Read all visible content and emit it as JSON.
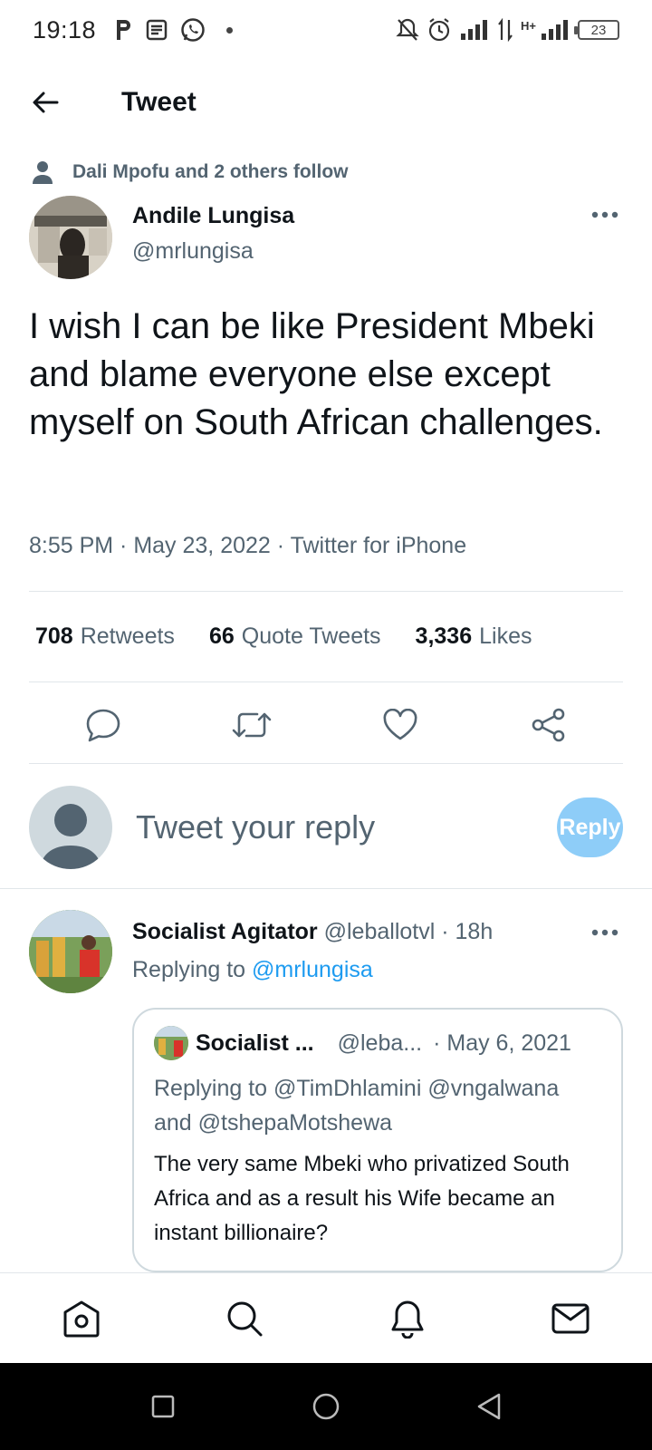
{
  "status_bar": {
    "time": "19:18",
    "battery": "23",
    "network": "H+"
  },
  "header": {
    "title": "Tweet",
    "back_icon": "arrow-left-icon"
  },
  "social_context": {
    "text": "Dali Mpofu and 2 others follow"
  },
  "tweet": {
    "author_name": "Andile Lungisa",
    "author_handle": "@mrlungisa",
    "text": "I wish I can be like President Mbeki and blame everyone else except myself on South African challenges.",
    "meta": "8:55 PM · May 23, 2022 · Twitter for iPhone",
    "stats": [
      {
        "count": "708",
        "label": "Retweets"
      },
      {
        "count": "66",
        "label": "Quote Tweets"
      },
      {
        "count": "3,336",
        "label": "Likes"
      }
    ]
  },
  "composer": {
    "placeholder": "Tweet your reply",
    "button_label": "Reply"
  },
  "reply": {
    "author_name": "Socialist Agitator",
    "author_handle": "@leballotvl",
    "time": "· 18h",
    "replying_prefix": "Replying to",
    "replying_to": "@mrlungisa",
    "quote": {
      "author_name": "Socialist ...",
      "author_handle": "@leba...",
      "date": "· May 6, 2021",
      "replying_line1": "Replying to @TimDhlamini @vngalwana",
      "replying_line2": "and @tshepaMotshewa",
      "text": "The very same Mbeki who privatized South Africa and as a result his Wife became an instant billionaire?"
    }
  },
  "colors": {
    "accent": "#1d9bf0",
    "reply_button": "#8ecdf8",
    "muted_text": "#536471",
    "divider": "#e1e6ea"
  }
}
